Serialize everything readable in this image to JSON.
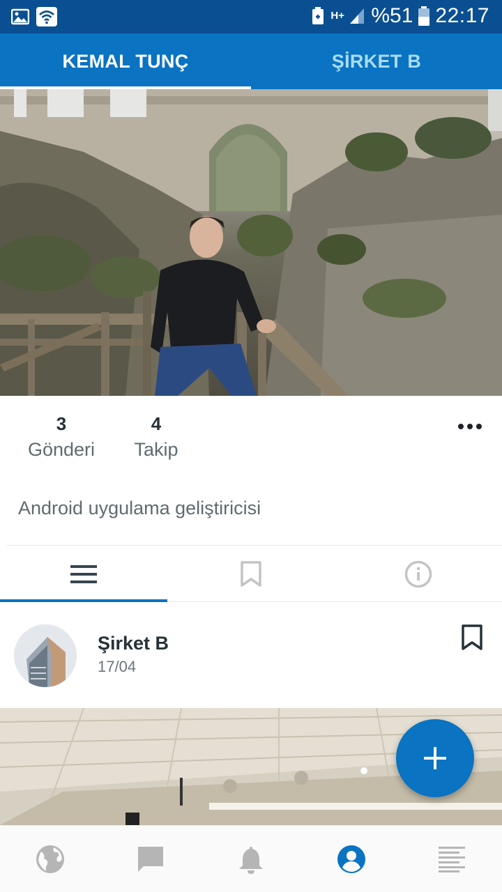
{
  "status_bar": {
    "battery_percent": "%51",
    "time": "22:17",
    "network_label": "H+"
  },
  "app_tabs": [
    {
      "label": "KEMAL TUNÇ",
      "active": true
    },
    {
      "label": "ŞİRKET B",
      "active": false
    }
  ],
  "profile": {
    "stats": [
      {
        "value": "3",
        "label": "Gönderi"
      },
      {
        "value": "4",
        "label": "Takip"
      }
    ],
    "bio": "Android uygulama geliştiricisi"
  },
  "profile_tabs": [
    {
      "icon": "list-icon",
      "active": true
    },
    {
      "icon": "bookmark-icon",
      "active": false
    },
    {
      "icon": "info-icon",
      "active": false
    }
  ],
  "post": {
    "author": "Şirket B",
    "date": "17/04"
  },
  "bottom_nav": [
    {
      "icon": "globe-icon",
      "active": false
    },
    {
      "icon": "chat-icon",
      "active": false
    },
    {
      "icon": "bell-icon",
      "active": false
    },
    {
      "icon": "profile-icon",
      "active": true
    },
    {
      "icon": "feed-icon",
      "active": false
    }
  ],
  "colors": {
    "status_bar": "#0a4f91",
    "primary": "#0a73c2",
    "inactive_tab_text": "#a9dcf7",
    "inactive_icon": "#bdbdbd"
  }
}
